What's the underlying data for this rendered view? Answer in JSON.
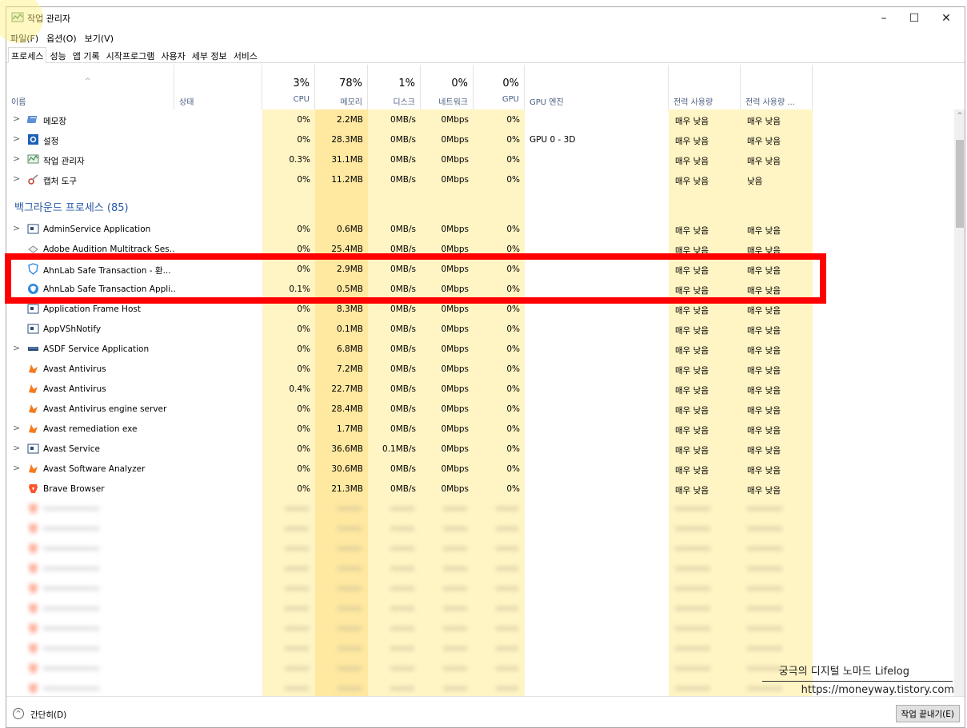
{
  "window": {
    "title": "작업 관리자"
  },
  "menu": [
    "파일(F)",
    "옵션(O)",
    "보기(V)"
  ],
  "tabs": [
    "프로세스",
    "성능",
    "앱 기록",
    "시작프로그램",
    "사용자",
    "세부 정보",
    "서비스"
  ],
  "columns": {
    "name": "이름",
    "status": "상태",
    "cpu": {
      "pct": "3%",
      "label": "CPU"
    },
    "memory": {
      "pct": "78%",
      "label": "메모리"
    },
    "disk": {
      "pct": "1%",
      "label": "디스크"
    },
    "network": {
      "pct": "0%",
      "label": "네트워크"
    },
    "gpu": {
      "pct": "0%",
      "label": "GPU"
    },
    "gpu_engine": "GPU 엔진",
    "power": "전력 사용량",
    "power_trend": "전력 사용량 ..."
  },
  "apps": [
    {
      "name": "메모장",
      "icon": "notepad-icon",
      "expand": true,
      "cpu": "0%",
      "mem": "2.2MB",
      "disk": "0MB/s",
      "net": "0Mbps",
      "gpu": "0%",
      "engine": "",
      "power": "매우 낮음",
      "trend": "매우 낮음"
    },
    {
      "name": "설정",
      "icon": "settings-gear-icon",
      "expand": true,
      "cpu": "0%",
      "mem": "28.3MB",
      "disk": "0MB/s",
      "net": "0Mbps",
      "gpu": "0%",
      "engine": "GPU 0 - 3D",
      "power": "매우 낮음",
      "trend": "매우 낮음"
    },
    {
      "name": "작업 관리자",
      "icon": "task-manager-icon",
      "expand": true,
      "cpu": "0.3%",
      "mem": "31.1MB",
      "disk": "0MB/s",
      "net": "0Mbps",
      "gpu": "0%",
      "engine": "",
      "power": "매우 낮음",
      "trend": "매우 낮음"
    },
    {
      "name": "캡처 도구",
      "icon": "snipping-tool-icon",
      "expand": true,
      "cpu": "0%",
      "mem": "11.2MB",
      "disk": "0MB/s",
      "net": "0Mbps",
      "gpu": "0%",
      "engine": "",
      "power": "매우 낮음",
      "trend": "낮음"
    }
  ],
  "background_header": "백그라운드 프로세스 (85)",
  "background": [
    {
      "name": "AdminService Application",
      "icon": "service-window-icon",
      "expand": true,
      "cpu": "0%",
      "mem": "0.6MB",
      "disk": "0MB/s",
      "net": "0Mbps",
      "gpu": "0%",
      "power": "매우 낮음",
      "trend": "매우 낮음"
    },
    {
      "name": "Adobe Audition Multitrack Ses...",
      "icon": "adobe-audition-icon",
      "expand": false,
      "cpu": "0%",
      "mem": "25.4MB",
      "disk": "0MB/s",
      "net": "0Mbps",
      "gpu": "0%",
      "power": "매우 낮음",
      "trend": "매우 낮음"
    },
    {
      "name": "AhnLab Safe Transaction - 환...",
      "icon": "ahnlab-shield-icon",
      "expand": false,
      "cpu": "0%",
      "mem": "2.9MB",
      "disk": "0MB/s",
      "net": "0Mbps",
      "gpu": "0%",
      "power": "매우 낮음",
      "trend": "매우 낮음"
    },
    {
      "name": "AhnLab Safe Transaction Appli...",
      "icon": "ahnlab-badge-icon",
      "expand": false,
      "cpu": "0.1%",
      "mem": "0.5MB",
      "disk": "0MB/s",
      "net": "0Mbps",
      "gpu": "0%",
      "power": "매우 낮음",
      "trend": "매우 낮음"
    },
    {
      "name": "Application Frame Host",
      "icon": "service-window-icon",
      "expand": false,
      "cpu": "0%",
      "mem": "8.3MB",
      "disk": "0MB/s",
      "net": "0Mbps",
      "gpu": "0%",
      "power": "매우 낮음",
      "trend": "매우 낮음"
    },
    {
      "name": "AppVShNotify",
      "icon": "service-window-icon",
      "expand": false,
      "cpu": "0%",
      "mem": "0.1MB",
      "disk": "0MB/s",
      "net": "0Mbps",
      "gpu": "0%",
      "power": "매우 낮음",
      "trend": "매우 낮음"
    },
    {
      "name": "ASDF Service Application",
      "icon": "asdf-service-icon",
      "expand": true,
      "cpu": "0%",
      "mem": "6.8MB",
      "disk": "0MB/s",
      "net": "0Mbps",
      "gpu": "0%",
      "power": "매우 낮음",
      "trend": "매우 낮음"
    },
    {
      "name": "Avast Antivirus",
      "icon": "avast-icon",
      "expand": false,
      "cpu": "0%",
      "mem": "7.2MB",
      "disk": "0MB/s",
      "net": "0Mbps",
      "gpu": "0%",
      "power": "매우 낮음",
      "trend": "매우 낮음"
    },
    {
      "name": "Avast Antivirus",
      "icon": "avast-icon",
      "expand": false,
      "cpu": "0.4%",
      "mem": "22.7MB",
      "disk": "0MB/s",
      "net": "0Mbps",
      "gpu": "0%",
      "power": "매우 낮음",
      "trend": "매우 낮음"
    },
    {
      "name": "Avast Antivirus engine server",
      "icon": "avast-icon",
      "expand": false,
      "cpu": "0%",
      "mem": "28.4MB",
      "disk": "0MB/s",
      "net": "0Mbps",
      "gpu": "0%",
      "power": "매우 낮음",
      "trend": "매우 낮음"
    },
    {
      "name": "Avast remediation exe",
      "icon": "avast-icon",
      "expand": true,
      "cpu": "0%",
      "mem": "1.7MB",
      "disk": "0MB/s",
      "net": "0Mbps",
      "gpu": "0%",
      "power": "매우 낮음",
      "trend": "매우 낮음"
    },
    {
      "name": "Avast Service",
      "icon": "service-window-icon",
      "expand": true,
      "cpu": "0%",
      "mem": "36.6MB",
      "disk": "0.1MB/s",
      "net": "0Mbps",
      "gpu": "0%",
      "power": "매우 낮음",
      "trend": "매우 낮음"
    },
    {
      "name": "Avast Software Analyzer",
      "icon": "avast-icon",
      "expand": true,
      "cpu": "0%",
      "mem": "30.6MB",
      "disk": "0MB/s",
      "net": "0Mbps",
      "gpu": "0%",
      "power": "매우 낮음",
      "trend": "매우 낮음"
    },
    {
      "name": "Brave Browser",
      "icon": "brave-lion-icon",
      "expand": false,
      "cpu": "0%",
      "mem": "21.3MB",
      "disk": "0MB/s",
      "net": "0Mbps",
      "gpu": "0%",
      "power": "매우 낮음",
      "trend": "매우 낮음"
    }
  ],
  "watermark": {
    "line1": "궁극의 디지털 노마드 Lifelog",
    "line2": "https://moneyway.tistory.com"
  },
  "footer": {
    "fewer": "간단히(D)",
    "end_task": "작업 끝내기(E)"
  },
  "colors": {
    "highlight": "#ff0000",
    "heat_light": "#fff4c4",
    "heat_mid": "#ffe8a0",
    "group_header": "#2a58a8"
  }
}
